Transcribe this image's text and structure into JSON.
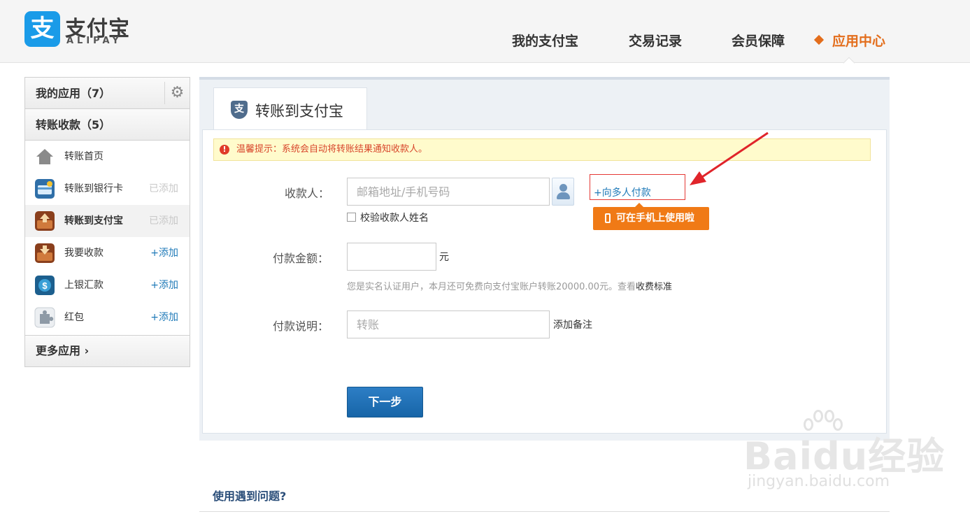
{
  "header": {
    "logo_icon": "支",
    "logo_cn": "支付宝",
    "logo_en": "ALIPAY",
    "nav": [
      {
        "label": "我的支付宝",
        "active": false
      },
      {
        "label": "交易记录",
        "active": false
      },
      {
        "label": "会员保障",
        "active": false
      },
      {
        "label": "应用中心",
        "active": true
      }
    ],
    "accent_color": "#e36d1b",
    "brand_color": "#1a9be8"
  },
  "sidebar": {
    "my_apps": "我的应用（7）",
    "settings_icon": "gear-icon",
    "transfer_group": "转账收款（5）",
    "items": [
      {
        "label": "转账首页",
        "status": "",
        "icon": "home-icon"
      },
      {
        "label": "转账到银行卡",
        "status": "已添加",
        "icon": "bank-card-icon"
      },
      {
        "label": "转账到支付宝",
        "status": "已添加",
        "icon": "alipay-transfer-icon",
        "selected": true
      },
      {
        "label": "我要收款",
        "status": "+添加",
        "icon": "receive-icon"
      },
      {
        "label": "上银汇款",
        "status": "+添加",
        "icon": "remittance-icon"
      },
      {
        "label": "红包",
        "status": "+添加",
        "icon": "puzzle-icon"
      }
    ],
    "more_apps": "更多应用"
  },
  "main": {
    "tab_icon": "支",
    "tab_label": "转账到支付宝",
    "tip_icon": "!",
    "tip": "温馨提示：系统会自动将转账结果通知收款人。",
    "payee_label": "收款人：",
    "payee_placeholder": "邮箱地址/手机号码",
    "multi_pay_link": "+向多人付款",
    "mobile_badge": "可在手机上使用啦",
    "verify_name": "校验收款人姓名",
    "amount_label": "付款金额：",
    "amount_unit": "元",
    "help_text": "您是实名认证用户，本月还可免费向支付宝账户转账20000.00元。查看",
    "help_link": "收费标准",
    "note_label": "付款说明：",
    "note_placeholder": "转账",
    "add_note": "添加备注",
    "next_button": "下一步"
  },
  "faq": {
    "title": "使用遇到问题?"
  },
  "watermark": {
    "main": "Baidu经验",
    "sub": "jingyan.baidu.com"
  }
}
